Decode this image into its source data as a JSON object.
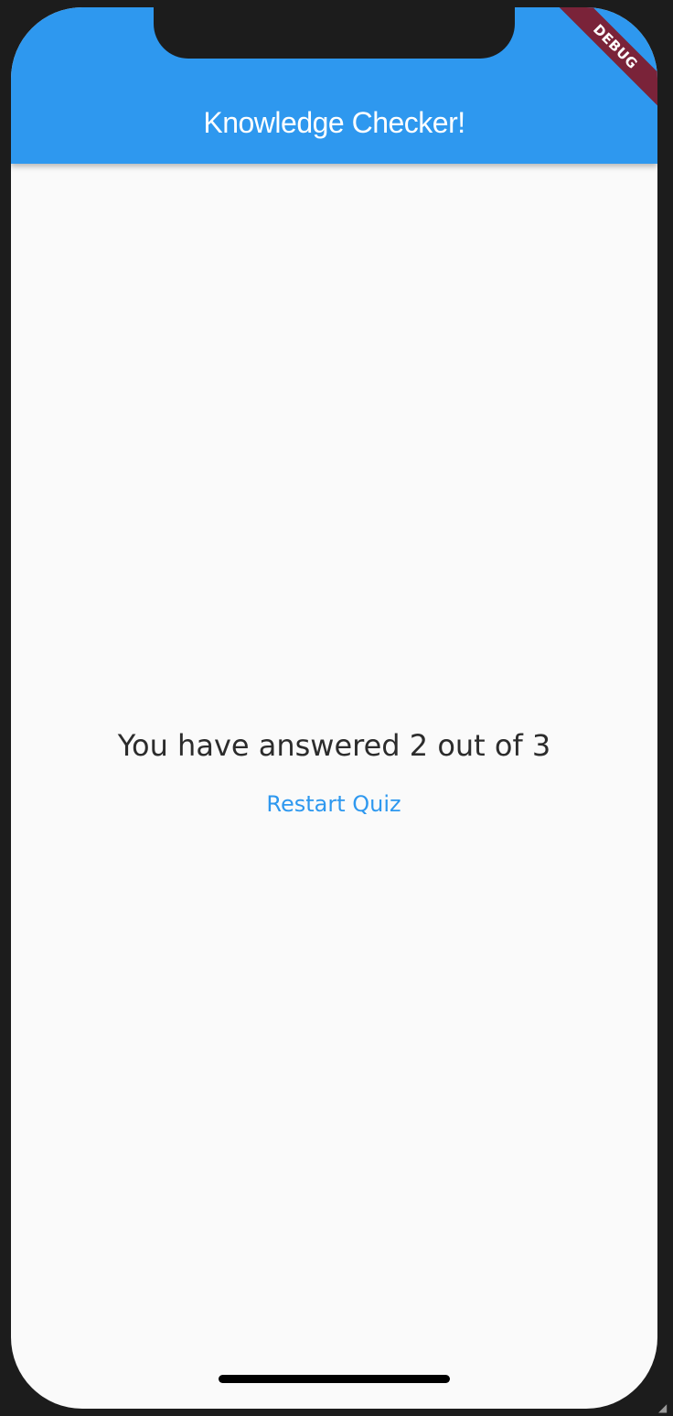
{
  "app_bar": {
    "title": "Knowledge Checker!",
    "color": "#2e98ef"
  },
  "debug_banner": {
    "label": "DEBUG",
    "color": "#7a2339"
  },
  "result": {
    "text": "You have answered 2 out of 3"
  },
  "restart_button": {
    "label": "Restart Quiz",
    "color": "#2e98ef"
  },
  "corner_mark": {
    "glyph": "◢"
  }
}
